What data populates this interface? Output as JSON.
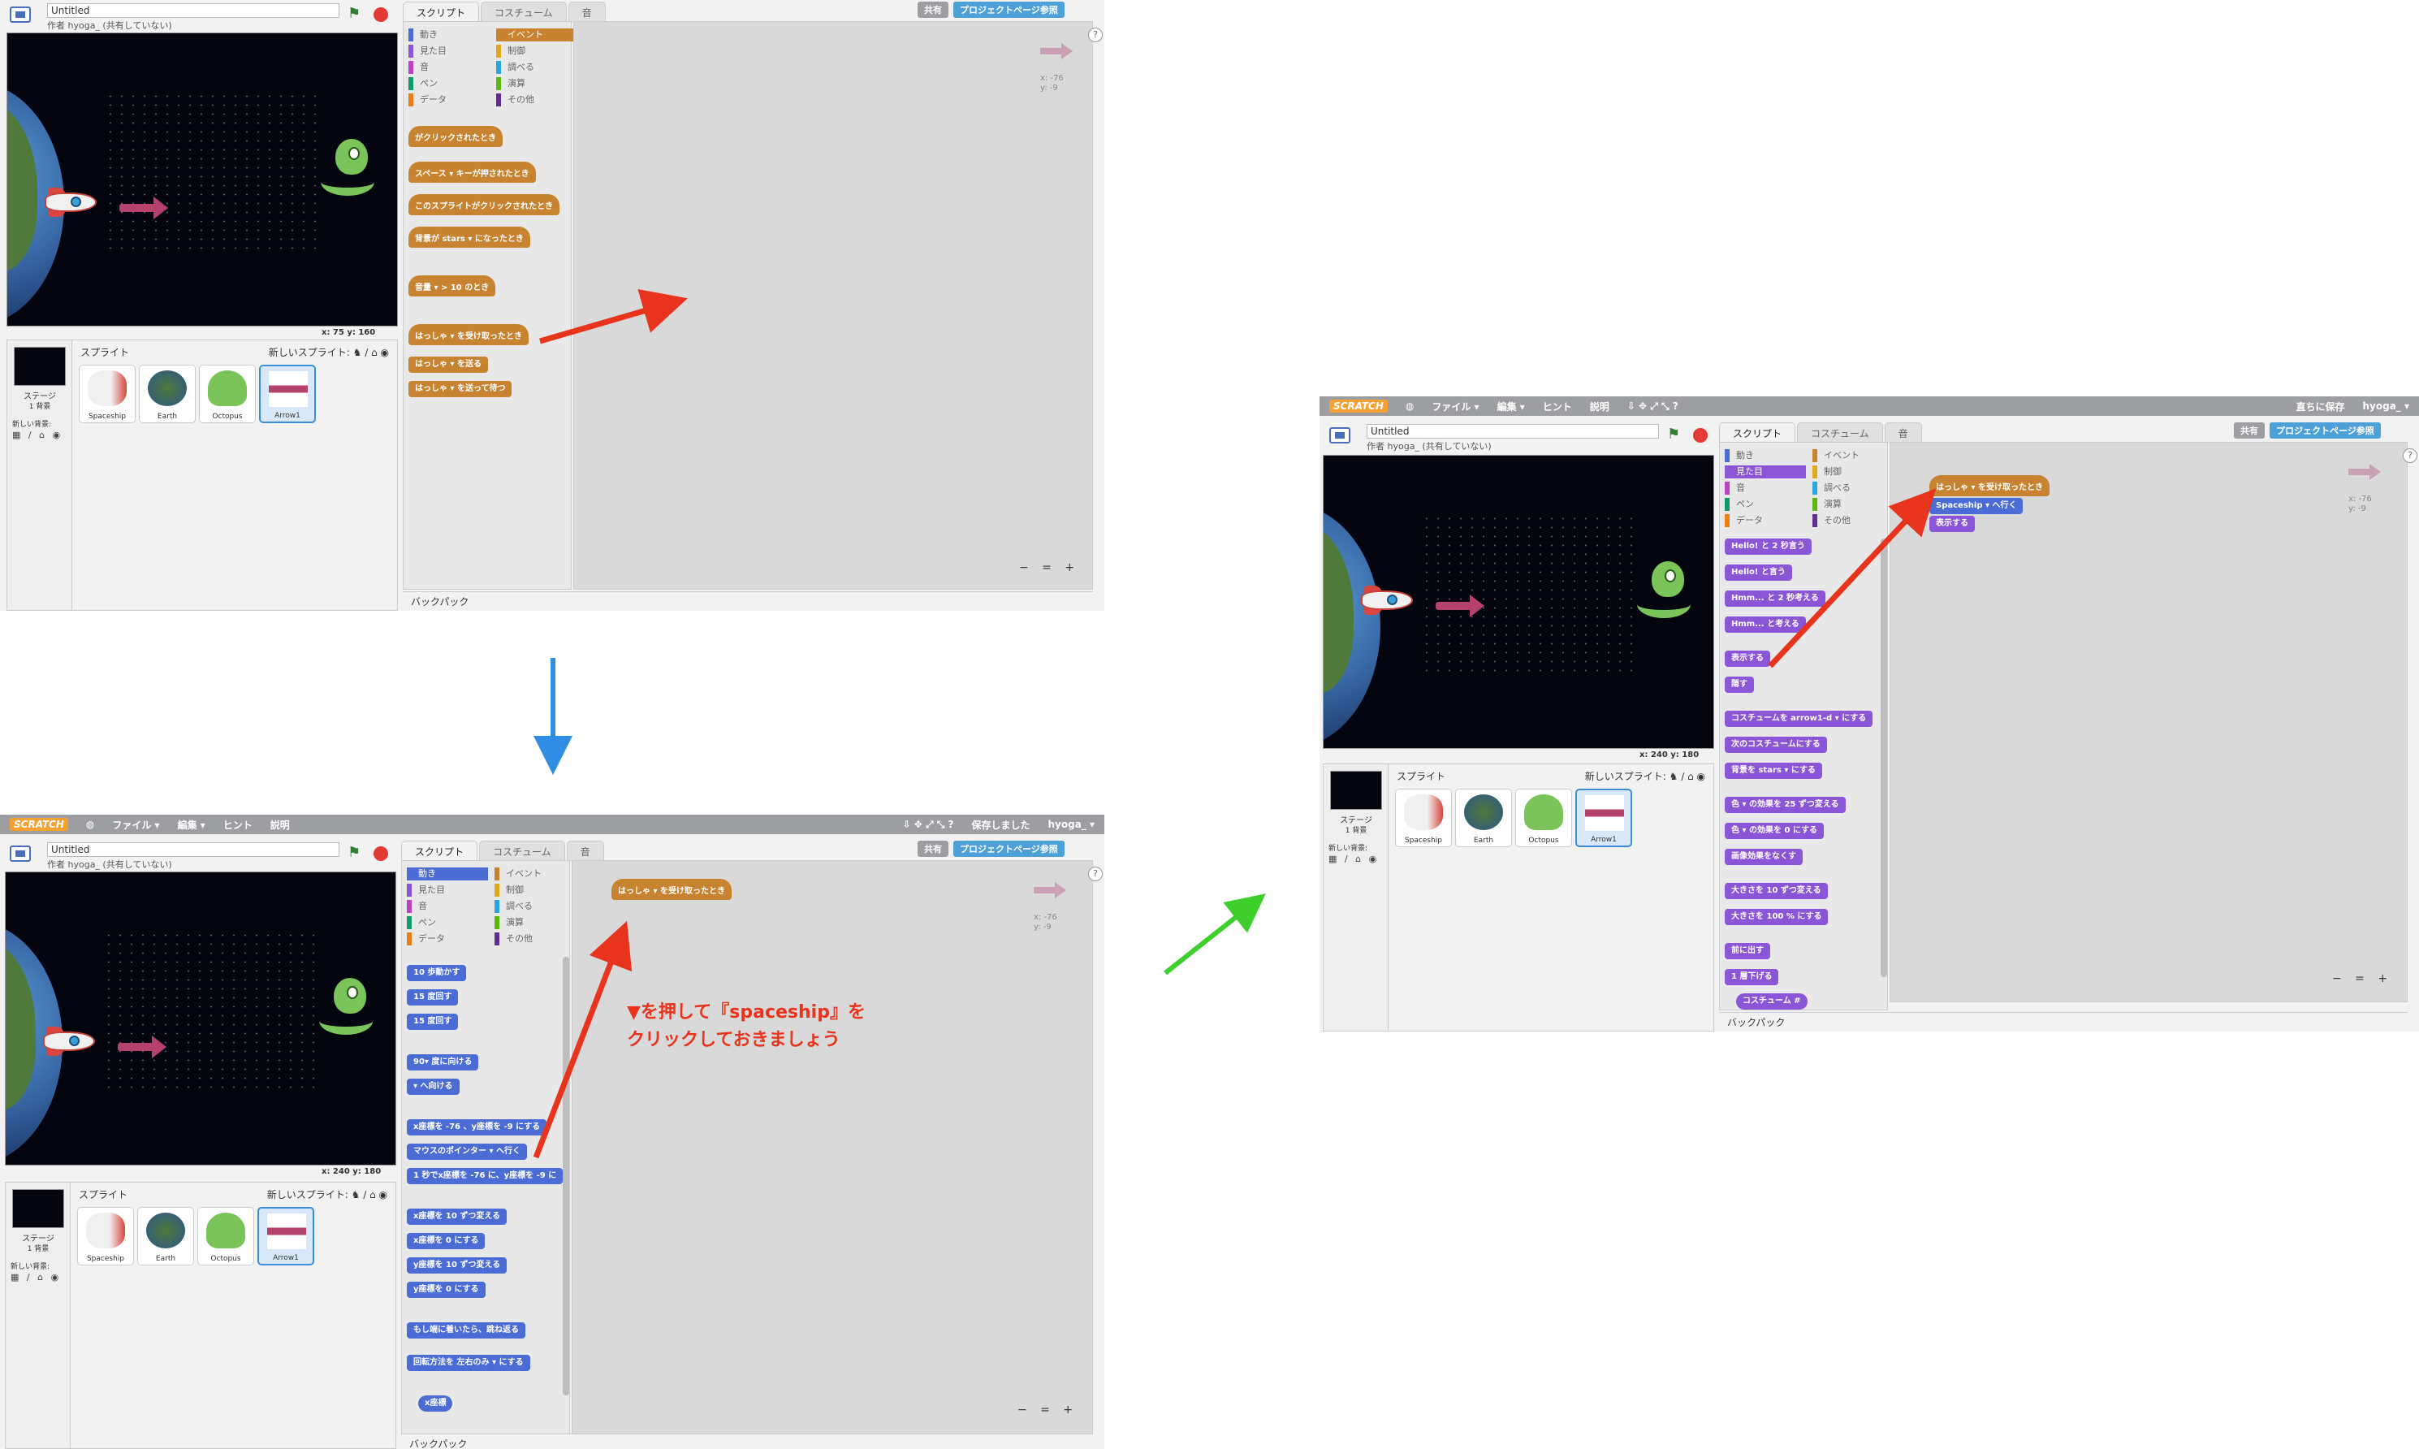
{
  "common": {
    "project_title": "Untitled",
    "author": "作者 hyoga_ (共有していない)",
    "tabs": {
      "scripts": "スクリプト",
      "costumes": "コスチューム",
      "sounds": "音"
    },
    "sprites_label": "スプライト",
    "new_sprite_label": "新しいスプライト:",
    "stage_label": "ステージ",
    "stage_sub": "1 背景",
    "new_backdrop": "新しい背景:",
    "sprites": [
      "Spaceship",
      "Earth",
      "Octopus",
      "Arrow1"
    ],
    "share_button": "共有",
    "project_page_button": "プロジェクトページ参照",
    "backpack": "バックパック",
    "sprite_x": "x: -76",
    "sprite_y": "y: -9",
    "help": "?",
    "zoom": "− = +",
    "categories": {
      "motion": "動き",
      "looks": "見た目",
      "sound": "音",
      "pen": "ペン",
      "data": "データ",
      "events": "イベント",
      "control": "制御",
      "sensing": "調べる",
      "operators": "演算",
      "more": "その他"
    },
    "colors": {
      "events": "#c88330",
      "motion": "#4a6cd4",
      "looks": "#8a55d7",
      "annotation": "#e8341c",
      "down_arrow": "#2f8de4",
      "green_arrow": "#3fcf2c"
    }
  },
  "menubar": {
    "logo": "SCRATCH",
    "file": "ファイル ▾",
    "edit": "編集 ▾",
    "tips": "ヒント",
    "about": "説明",
    "user": "hyoga_ ▾",
    "saved_status": "保存しました",
    "save_now": "直ちに保存"
  },
  "shot1": {
    "coords": "x: 75   y: 160",
    "event_blocks": [
      "がクリックされたとき",
      "スペース ▾ キーが押されたとき",
      "このスプライトがクリックされたとき",
      "背景が stars ▾ になったとき",
      "音量 ▾ > 10 のとき",
      "はっしゃ ▾ を受け取ったとき",
      "はっしゃ ▾ を送る",
      "はっしゃ ▾ を送って待つ"
    ]
  },
  "shot2": {
    "coords": "x: 240   y: 180",
    "motion_blocks": [
      "10 歩動かす",
      "15 度回す",
      "15 度回す",
      "90▾ 度に向ける",
      "▾ へ向ける",
      "x座標を -76 、y座標を -9 にする",
      "マウスのポインター ▾ へ行く",
      "1 秒でx座標を -76 に、y座標を -9 に",
      "x座標を 10 ずつ変える",
      "x座標を 0 にする",
      "y座標を 10 ずつ変える",
      "y座標を 0 にする",
      "もし端に着いたら、跳ね返る",
      "回転方法を 左右のみ ▾ にする",
      "x座標"
    ],
    "script_hat": "はっしゃ ▾ を受け取ったとき",
    "annotation_line1": "▼を押して『spaceship』を",
    "annotation_line2": "クリックしておきましょう"
  },
  "shot3": {
    "coords": "x: 240   y: 180",
    "looks_blocks": [
      "Hello! と 2 秒言う",
      "Hello! と言う",
      "Hmm... と 2 秒考える",
      "Hmm... と考える",
      "表示する",
      "隠す",
      "コスチュームを arrow1-d ▾ にする",
      "次のコスチュームにする",
      "背景を stars ▾ にする",
      "色 ▾ の効果を 25 ずつ変える",
      "色 ▾ の効果を 0 にする",
      "画像効果をなくす",
      "大きさを 10 ずつ変える",
      "大きさを 100 % にする",
      "前に出す",
      "1 層下げる",
      "コスチューム #"
    ],
    "script": [
      "はっしゃ ▾ を受け取ったとき",
      "Spaceship ▾ へ行く",
      "表示する"
    ]
  }
}
